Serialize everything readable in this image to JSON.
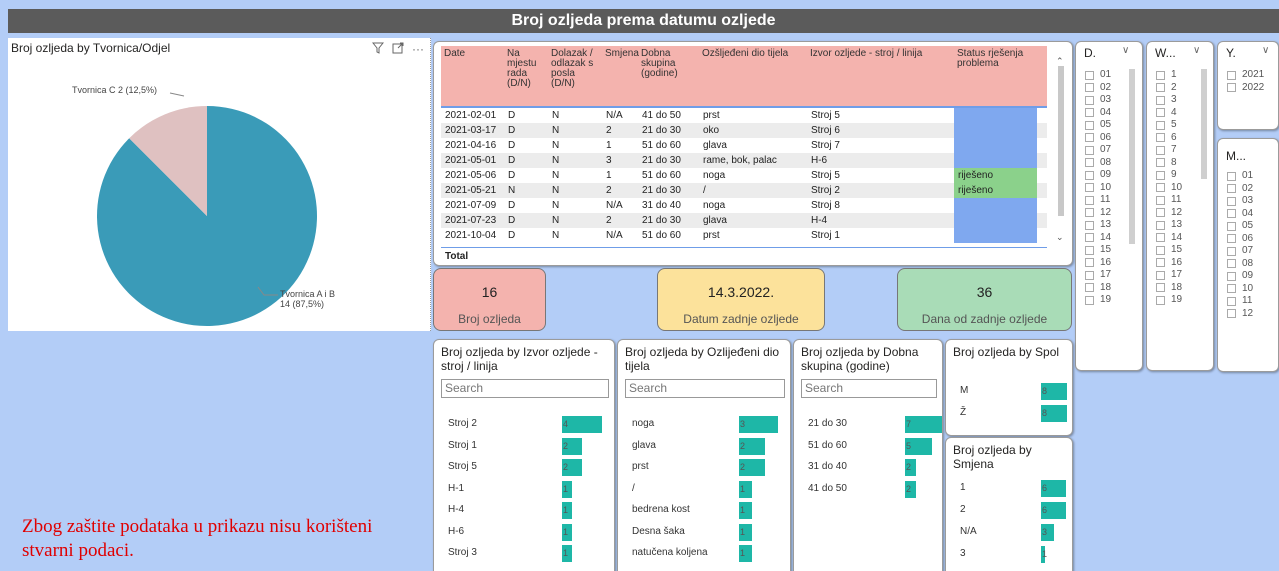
{
  "report_title": "Broj ozljeda prema datumu ozljede",
  "pie": {
    "title": "Broj ozljeda by Tvornica/Odjel",
    "label_a": "Tvornica A i B",
    "label_a_value": "14 (87,5%)",
    "label_c": "Tvornica C 2 (12,5%)",
    "colors": {
      "a": "#3a9bb8",
      "c": "#dfc1c1"
    }
  },
  "chart_data": {
    "type": "pie",
    "title": "Broj ozljeda by Tvornica/Odjel",
    "categories": [
      "Tvornica A i B",
      "Tvornica C"
    ],
    "values": [
      14,
      2
    ]
  },
  "table": {
    "headers": [
      "Date",
      "Na mjestu rada (D/N)",
      "Dolazak / odlazak s posla (D/N)",
      "Smjena",
      "Dobna skupina (godine)",
      "Ozšljeđeni dio tijela",
      "Izvor ozljede - stroj / linija",
      "Status rješenja problema"
    ],
    "rows": [
      [
        "2021-02-01",
        "D",
        "N",
        "N/A",
        "41 do 50",
        "prst",
        "Stroj 5",
        ""
      ],
      [
        "2021-03-17",
        "D",
        "N",
        "2",
        "21 do 30",
        "oko",
        "Stroj 6",
        ""
      ],
      [
        "2021-04-16",
        "D",
        "N",
        "1",
        "51 do 60",
        "glava",
        "Stroj 7",
        ""
      ],
      [
        "2021-05-01",
        "D",
        "N",
        "3",
        "21 do 30",
        "rame, bok, palac",
        "H-6",
        ""
      ],
      [
        "2021-05-06",
        "D",
        "N",
        "1",
        "51 do 60",
        "noga",
        "Stroj 5",
        "riješeno"
      ],
      [
        "2021-05-21",
        "N",
        "N",
        "2",
        "21 do 30",
        "/",
        "Stroj 2",
        "riješeno"
      ],
      [
        "2021-07-09",
        "D",
        "N",
        "N/A",
        "31 do 40",
        "noga",
        "Stroj 8",
        ""
      ],
      [
        "2021-07-23",
        "D",
        "N",
        "2",
        "21 do 30",
        "glava",
        "H-4",
        ""
      ],
      [
        "2021-10-04",
        "D",
        "N",
        "N/A",
        "51 do 60",
        "prst",
        "Stroj 1",
        ""
      ]
    ],
    "total_label": "Total",
    "status_colors": {
      "open": "#7fa8ef",
      "solved": "#8bd18b"
    }
  },
  "kpis": [
    {
      "value": "16",
      "label": "Broj ozljeda",
      "color": "#f4b3ae"
    },
    {
      "value": "14.3.2022.",
      "label": "Datum zadnje ozljede",
      "color": "#fce29b"
    },
    {
      "value": "36",
      "label": "Dana od zadnje ozljede",
      "color": "#a9dcb7"
    }
  ],
  "slicers": {
    "day": {
      "title": "D.",
      "items": [
        "01",
        "02",
        "03",
        "04",
        "05",
        "06",
        "07",
        "08",
        "09",
        "10",
        "11",
        "12",
        "13",
        "14",
        "15",
        "16",
        "17",
        "18",
        "19"
      ]
    },
    "week": {
      "title": "W...",
      "items": [
        "1",
        "2",
        "3",
        "4",
        "5",
        "6",
        "7",
        "8",
        "9",
        "10",
        "11",
        "12",
        "13",
        "14",
        "15",
        "16",
        "17",
        "18",
        "19"
      ]
    },
    "year": {
      "title": "Y.",
      "items": [
        "2021",
        "2022"
      ]
    },
    "month": {
      "title": "M...",
      "items": [
        "01",
        "02",
        "03",
        "04",
        "05",
        "06",
        "07",
        "08",
        "09",
        "10",
        "11",
        "12"
      ]
    }
  },
  "bar_panels": {
    "izvor": {
      "title": "Broj ozljeda by Izvor ozljede - stroj / linija",
      "search": "Search",
      "rows": [
        [
          "Stroj 2",
          4
        ],
        [
          "Stroj 1",
          2
        ],
        [
          "Stroj 5",
          2
        ],
        [
          "H-1",
          1
        ],
        [
          "H-4",
          1
        ],
        [
          "H-6",
          1
        ],
        [
          "Stroj 3",
          1
        ]
      ]
    },
    "dio": {
      "title": "Broj ozljeda by Ozlijeđeni dio tijela",
      "search": "Search",
      "rows": [
        [
          "noga",
          3
        ],
        [
          "glava",
          2
        ],
        [
          "prst",
          2
        ],
        [
          "/",
          1
        ],
        [
          "bedrena kost",
          1
        ],
        [
          "Desna šaka",
          1
        ],
        [
          "natučena koljena",
          1
        ]
      ]
    },
    "dob": {
      "title": "Broj ozljeda by Dobna skupina (godine)",
      "search": "Search",
      "rows": [
        [
          "21 do 30",
          7
        ],
        [
          "51 do 60",
          5
        ],
        [
          "31 do 40",
          2
        ],
        [
          "41 do 50",
          2
        ]
      ]
    },
    "spol": {
      "title": "Broj ozljeda by Spol",
      "rows": [
        [
          "M",
          8
        ],
        [
          "Ž",
          8
        ]
      ]
    },
    "smjena": {
      "title": "Broj ozljeda by Smjena",
      "rows": [
        [
          "1",
          6
        ],
        [
          "2",
          6
        ],
        [
          "N/A",
          3
        ],
        [
          "3",
          1
        ]
      ]
    }
  },
  "disclaimer": "Zbog zaštite podataka u prikazu nisu korišteni stvarni podaci."
}
